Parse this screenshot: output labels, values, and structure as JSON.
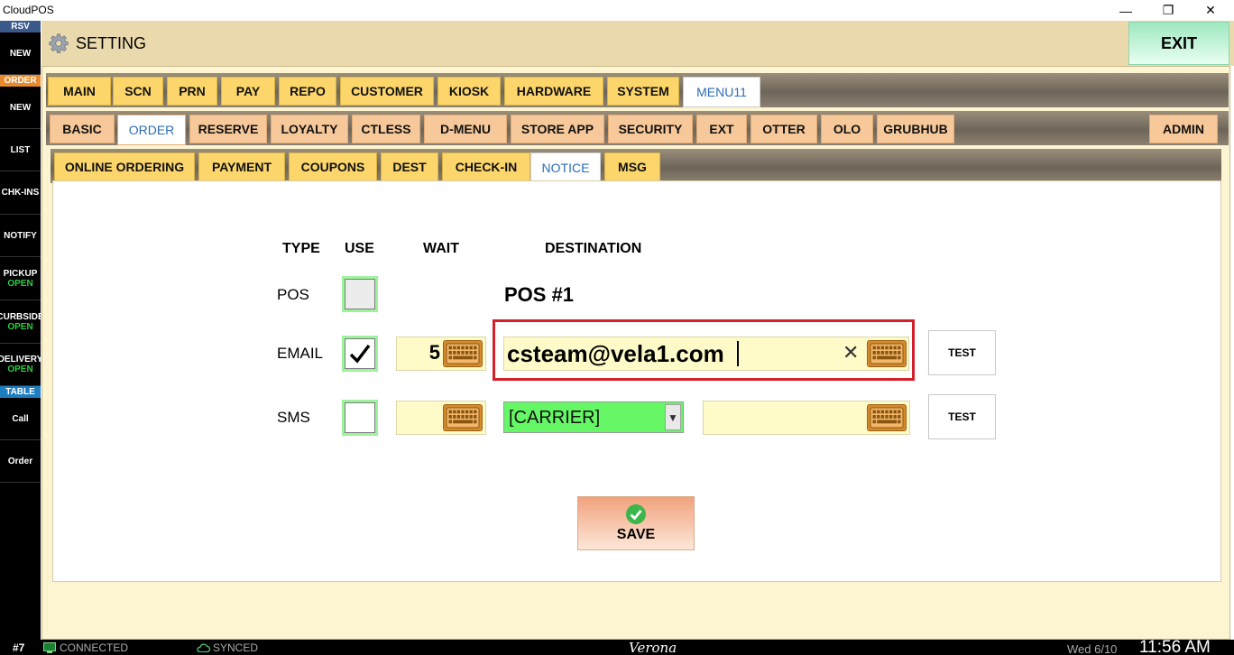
{
  "window": {
    "title": "CloudPOS",
    "minimize": "—",
    "maximize": "❐",
    "close": "✕"
  },
  "sidebar": [
    {
      "type": "head",
      "label": "RSV",
      "color": "#3a5a8c"
    },
    {
      "type": "item",
      "label": "NEW"
    },
    {
      "type": "head",
      "label": "ORDER",
      "color": "#e8892b"
    },
    {
      "type": "item",
      "label": "NEW"
    },
    {
      "type": "item",
      "label": "LIST"
    },
    {
      "type": "item",
      "label": "CHK-INS"
    },
    {
      "type": "item",
      "label": "NOTIFY"
    },
    {
      "type": "item",
      "label": "PICKUP",
      "sub": "OPEN"
    },
    {
      "type": "item",
      "label": "CURBSIDE",
      "sub": "OPEN"
    },
    {
      "type": "item",
      "label": "DELIVERY",
      "sub": "OPEN"
    },
    {
      "type": "head",
      "label": "TABLE",
      "color": "#1e7fc0"
    },
    {
      "type": "item",
      "label": "Call"
    },
    {
      "type": "item",
      "label": "Order"
    }
  ],
  "header": {
    "title": "SETTING",
    "exit_label": "EXIT"
  },
  "tabs_row1": [
    {
      "label": "MAIN"
    },
    {
      "label": "SCN"
    },
    {
      "label": "PRN"
    },
    {
      "label": "PAY"
    },
    {
      "label": "REPO"
    },
    {
      "label": "CUSTOMER"
    },
    {
      "label": "KIOSK"
    },
    {
      "label": "HARDWARE"
    },
    {
      "label": "SYSTEM"
    },
    {
      "label": "MENU11",
      "active": true
    }
  ],
  "tabs_row2": [
    {
      "label": "BASIC"
    },
    {
      "label": "ORDER",
      "active": true
    },
    {
      "label": "RESERVE"
    },
    {
      "label": "LOYALTY"
    },
    {
      "label": "CTLESS"
    },
    {
      "label": "D-MENU"
    },
    {
      "label": "STORE APP"
    },
    {
      "label": "SECURITY"
    },
    {
      "label": "EXT"
    },
    {
      "label": "OTTER"
    },
    {
      "label": "OLO"
    },
    {
      "label": "GRUBHUB"
    },
    {
      "label": "ADMIN"
    }
  ],
  "tabs_row3": [
    {
      "label": "ONLINE ORDERING"
    },
    {
      "label": "PAYMENT"
    },
    {
      "label": "COUPONS"
    },
    {
      "label": "DEST"
    },
    {
      "label": "CHECK-IN"
    },
    {
      "label": "NOTICE",
      "active": true
    },
    {
      "label": "MSG"
    }
  ],
  "notice": {
    "col_type": "TYPE",
    "col_use": "USE",
    "col_wait": "WAIT",
    "col_destination": "DESTINATION",
    "pos": {
      "label": "POS",
      "checked": false,
      "destination": "POS #1"
    },
    "email": {
      "label": "EMAIL",
      "checked": true,
      "wait": "5",
      "destination": "csteam@vela1.com",
      "test_label": "TEST"
    },
    "sms": {
      "label": "SMS",
      "checked": false,
      "wait": "",
      "carrier": "[CARRIER]",
      "number": "",
      "test_label": "TEST"
    },
    "save_label": "SAVE"
  },
  "statusbar": {
    "terminal": "#7",
    "connection": "CONNECTED",
    "sync": "SYNCED",
    "store": "Verona",
    "date": "Wed 6/10",
    "time": "11:56 AM"
  }
}
